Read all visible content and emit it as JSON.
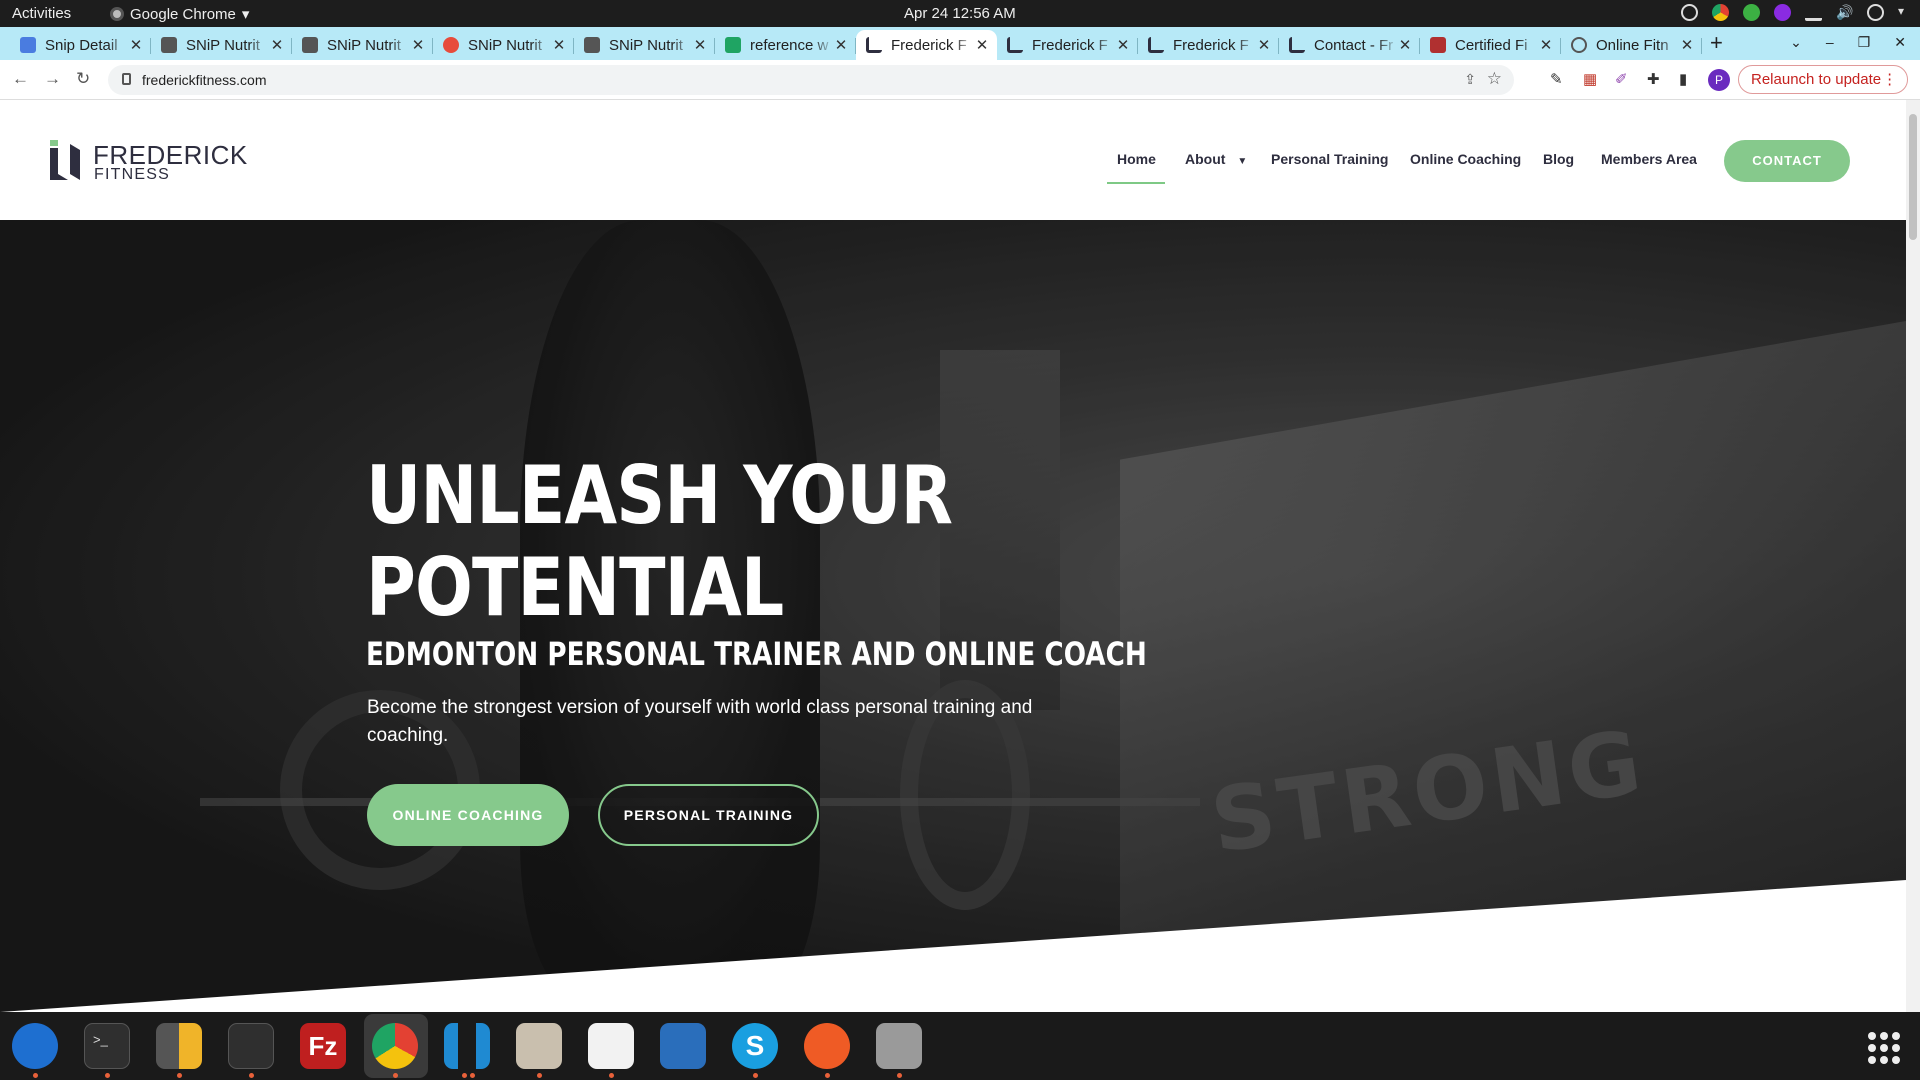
{
  "system": {
    "activities": "Activities",
    "app_name": "Google Chrome",
    "clock": "Apr 24  12:56 AM"
  },
  "tabs": [
    {
      "title": "Snip Detail",
      "icon": "docs-icon",
      "color": "#4a7ce0"
    },
    {
      "title": "SNiP Nutrit",
      "icon": "snip-icon",
      "color": "#444"
    },
    {
      "title": "SNiP Nutrit",
      "icon": "snip-icon",
      "color": "#444"
    },
    {
      "title": "SNiP Nutrit",
      "icon": "chrome-icon",
      "color": "#e74c3c"
    },
    {
      "title": "SNiP Nutrit",
      "icon": "snip-icon",
      "color": "#444"
    },
    {
      "title": "reference w",
      "icon": "sheets-icon",
      "color": "#1fa463"
    },
    {
      "title": "Frederick F",
      "icon": "frederick-icon",
      "color": "#2e2e3f",
      "active": true
    },
    {
      "title": "Frederick F",
      "icon": "frederick-icon",
      "color": "#2e2e3f"
    },
    {
      "title": "Frederick F",
      "icon": "frederick-icon",
      "color": "#2e2e3f"
    },
    {
      "title": "Contact - Fr",
      "icon": "frederick-icon",
      "color": "#2e2e3f"
    },
    {
      "title": "Certified Fi",
      "icon": "cert-icon",
      "color": "#b03030"
    },
    {
      "title": "Online Fitn",
      "icon": "globe-icon",
      "color": "#555"
    }
  ],
  "address": {
    "url": "frederickfitness.com",
    "relaunch": "Relaunch to update",
    "profile_initial": "P"
  },
  "site": {
    "logo_line1": "FREDERICK",
    "logo_line2": "FITNESS",
    "nav": {
      "home": "Home",
      "about": "About",
      "personal_training": "Personal Training",
      "online_coaching": "Online Coaching",
      "blog": "Blog",
      "members": "Members Area",
      "contact": "CONTACT"
    },
    "hero": {
      "headline": "UNLEASH YOUR POTENTIAL",
      "subhead": "EDMONTON PERSONAL TRAINER AND ONLINE COACH",
      "lead": "Become the strongest version of yourself with world class personal training and coaching.",
      "btn_online": "ONLINE COACHING",
      "btn_personal": "PERSONAL TRAINING",
      "box_text": "STRONG"
    },
    "accent": "#86c98c"
  },
  "dock": [
    {
      "name": "thunderbird-icon",
      "color": "#1e6fd0"
    },
    {
      "name": "terminal-icon",
      "color": "#2f2f2f"
    },
    {
      "name": "calculator-icon",
      "color": "#f0b429"
    },
    {
      "name": "system-monitor-icon",
      "color": "#2f2f2f"
    },
    {
      "name": "filezilla-icon",
      "color": "#bf1f1f"
    },
    {
      "name": "chrome-icon",
      "color": "#e34133"
    },
    {
      "name": "vscode-icon",
      "color": "#1f8ad2"
    },
    {
      "name": "files-icon",
      "color": "#c9bfae"
    },
    {
      "name": "text-editor-icon",
      "color": "#f2f2f2"
    },
    {
      "name": "document-viewer-icon",
      "color": "#2a6ebb"
    },
    {
      "name": "skype-icon",
      "color": "#1a9fe0"
    },
    {
      "name": "postman-icon",
      "color": "#ef5b25"
    },
    {
      "name": "disks-icon",
      "color": "#9a9a9a"
    }
  ]
}
